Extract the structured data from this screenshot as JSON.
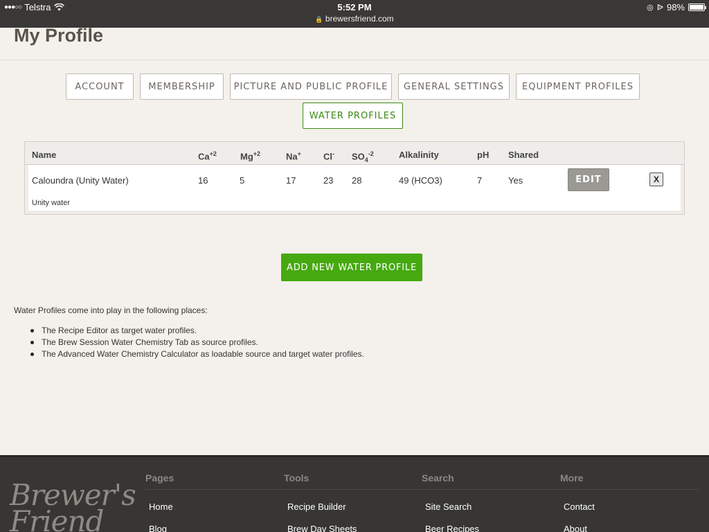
{
  "status_bar": {
    "carrier": "Telstra",
    "time": "5:52 PM",
    "url": "brewersfriend.com",
    "battery": "98%",
    "battery_level": 0.98
  },
  "page": {
    "title": "My Profile"
  },
  "tabs": [
    {
      "label": "ACCOUNT"
    },
    {
      "label": "MEMBERSHIP"
    },
    {
      "label": "PICTURE AND PUBLIC PROFILE"
    },
    {
      "label": "GENERAL SETTINGS"
    },
    {
      "label": "EQUIPMENT PROFILES"
    },
    {
      "label": "WATER PROFILES",
      "active": true
    }
  ],
  "table": {
    "headers": {
      "name": "Name",
      "ca": "Ca",
      "ca_sup": "+2",
      "mg": "Mg",
      "mg_sup": "+2",
      "na": "Na",
      "na_sup": "+",
      "cl": "Cl",
      "cl_sup": "-",
      "so4": "SO",
      "so4_sub": "4",
      "so4_sup": "-2",
      "alkalinity": "Alkalinity",
      "ph": "pH",
      "shared": "Shared"
    },
    "rows": [
      {
        "name": "Caloundra (Unity Water)",
        "ca": "16",
        "mg": "5",
        "na": "17",
        "cl": "23",
        "so4": "28",
        "alkalinity": "49 (HCO3)",
        "ph": "7",
        "shared": "Yes",
        "edit_label": "EDIT",
        "delete_label": "X",
        "note": "Unity water"
      }
    ]
  },
  "add_button": {
    "label": "ADD NEW WATER PROFILE"
  },
  "info": {
    "intro": "Water Profiles come into play in the following places:",
    "items": [
      "The Recipe Editor as target water profiles.",
      "The Brew Session Water Chemistry Tab as source profiles.",
      "The Advanced Water Chemistry Calculator as loadable source and target water profiles."
    ]
  },
  "footer": {
    "logo_text": "Brewer's Friend",
    "columns": [
      {
        "heading": "Pages",
        "links": [
          "Home",
          "Blog"
        ]
      },
      {
        "heading": "Tools",
        "links": [
          "Recipe Builder",
          "Brew Day Sheets"
        ]
      },
      {
        "heading": "Search",
        "links": [
          "Site Search",
          "Beer Recipes"
        ]
      },
      {
        "heading": "More",
        "links": [
          "Contact",
          "About"
        ]
      }
    ]
  },
  "colors": {
    "accent_green": "#46a90f",
    "active_tab": "#3c8a12",
    "footer_bg": "#373634",
    "status_bar_bg": "#3a3836"
  }
}
